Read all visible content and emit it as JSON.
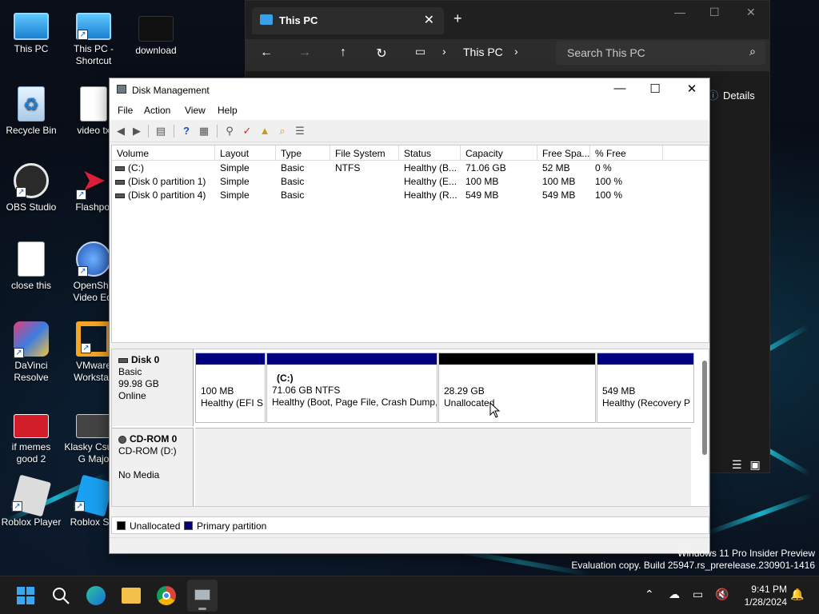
{
  "desktop": {
    "icons": [
      {
        "label": "This PC"
      },
      {
        "label": "This PC - Shortcut"
      },
      {
        "label": "download"
      },
      {
        "label": "Recycle Bin"
      },
      {
        "label": "video tx"
      },
      {
        "label": "OBS Studio"
      },
      {
        "label": "Flashpoi"
      },
      {
        "label": "close this"
      },
      {
        "label": "OpenSho Video Edi"
      },
      {
        "label": "DaVinci Resolve"
      },
      {
        "label": "VMware Workstati"
      },
      {
        "label": "if memes good 2"
      },
      {
        "label": "Klasky Csu In G Majo"
      },
      {
        "label": "Roblox Player"
      },
      {
        "label": "Roblox Stu"
      }
    ]
  },
  "explorer": {
    "tab_title": "This PC",
    "close_tab": "✕",
    "new_tab": "+",
    "address": "This PC",
    "search_placeholder": "Search This PC",
    "details_label": "Details"
  },
  "disk_mgmt": {
    "title": "Disk Management",
    "menu": [
      "File",
      "Action",
      "View",
      "Help"
    ],
    "columns": [
      "Volume",
      "Layout",
      "Type",
      "File System",
      "Status",
      "Capacity",
      "Free Spa...",
      "% Free"
    ],
    "volumes": [
      {
        "volume": "(C:)",
        "layout": "Simple",
        "type": "Basic",
        "fs": "NTFS",
        "status": "Healthy (B...",
        "capacity": "71.06 GB",
        "free": "52 MB",
        "pct": "0 %"
      },
      {
        "volume": "(Disk 0 partition 1)",
        "layout": "Simple",
        "type": "Basic",
        "fs": "",
        "status": "Healthy (E...",
        "capacity": "100 MB",
        "free": "100 MB",
        "pct": "100 %"
      },
      {
        "volume": "(Disk 0 partition 4)",
        "layout": "Simple",
        "type": "Basic",
        "fs": "",
        "status": "Healthy (R...",
        "capacity": "549 MB",
        "free": "549 MB",
        "pct": "100 %"
      }
    ],
    "disk0": {
      "name": "Disk 0",
      "type": "Basic",
      "size": "99.98 GB",
      "state": "Online",
      "partitions": [
        {
          "title": "",
          "line1": "100 MB",
          "line2": "Healthy (EFI S",
          "bar_color": "#000080"
        },
        {
          "title": "(C:)",
          "line1": "71.06 GB NTFS",
          "line2": "Healthy (Boot, Page File, Crash Dump,",
          "bar_color": "#000080"
        },
        {
          "title": "",
          "line1": "28.29 GB",
          "line2": "Unallocated",
          "bar_color": "#000000"
        },
        {
          "title": "",
          "line1": "549 MB",
          "line2": "Healthy (Recovery P",
          "bar_color": "#000080"
        }
      ]
    },
    "cdrom": {
      "name": "CD-ROM 0",
      "line1": "CD-ROM (D:)",
      "line2": "No Media"
    },
    "legend": {
      "unallocated": "Unallocated",
      "primary": "Primary partition",
      "unallocated_color": "#000000",
      "primary_color": "#000080"
    }
  },
  "watermark": {
    "line1": "Windows 11 Pro Insider Preview",
    "line2": "Evaluation copy. Build 25947.rs_prerelease.230901-1416"
  },
  "taskbar": {
    "time": "9:41 PM",
    "date": "1/28/2024"
  },
  "colors": {
    "accent": "#0078d4",
    "primary_partition": "#000080",
    "unallocated": "#000000"
  }
}
